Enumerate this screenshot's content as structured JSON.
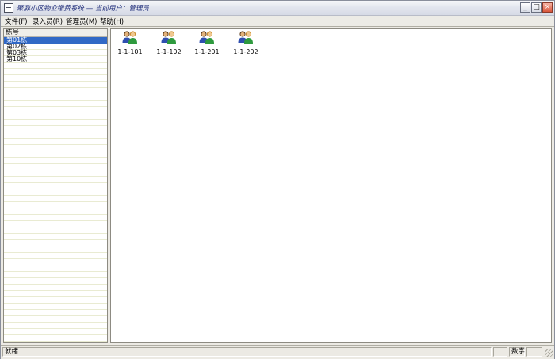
{
  "window": {
    "title": "聚鼎小区物业缴费系统 —  当前用户：管理员"
  },
  "title_buttons": {
    "minimize": "_",
    "maximize": "□",
    "close": "×"
  },
  "menu": [
    {
      "label": "文件(F)"
    },
    {
      "label": "录入员(R)"
    },
    {
      "label": "管理员(M)"
    },
    {
      "label": "帮助(H)"
    }
  ],
  "sidebar": {
    "header": "栋号",
    "items": [
      {
        "label": "第01栋",
        "selected": true
      },
      {
        "label": "第02栋",
        "selected": false
      },
      {
        "label": "第03栋",
        "selected": false
      },
      {
        "label": "第10栋",
        "selected": false
      }
    ]
  },
  "rooms": [
    {
      "label": "1-1-101",
      "icon": "users-icon"
    },
    {
      "label": "1-1-102",
      "icon": "users-icon"
    },
    {
      "label": "1-1-201",
      "icon": "users-icon"
    },
    {
      "label": "1-1-202",
      "icon": "users-icon"
    }
  ],
  "statusbar": {
    "status": "就绪",
    "mode": "数字"
  },
  "colors": {
    "selection": "#3169c6",
    "title_text": "#1c2a78"
  }
}
